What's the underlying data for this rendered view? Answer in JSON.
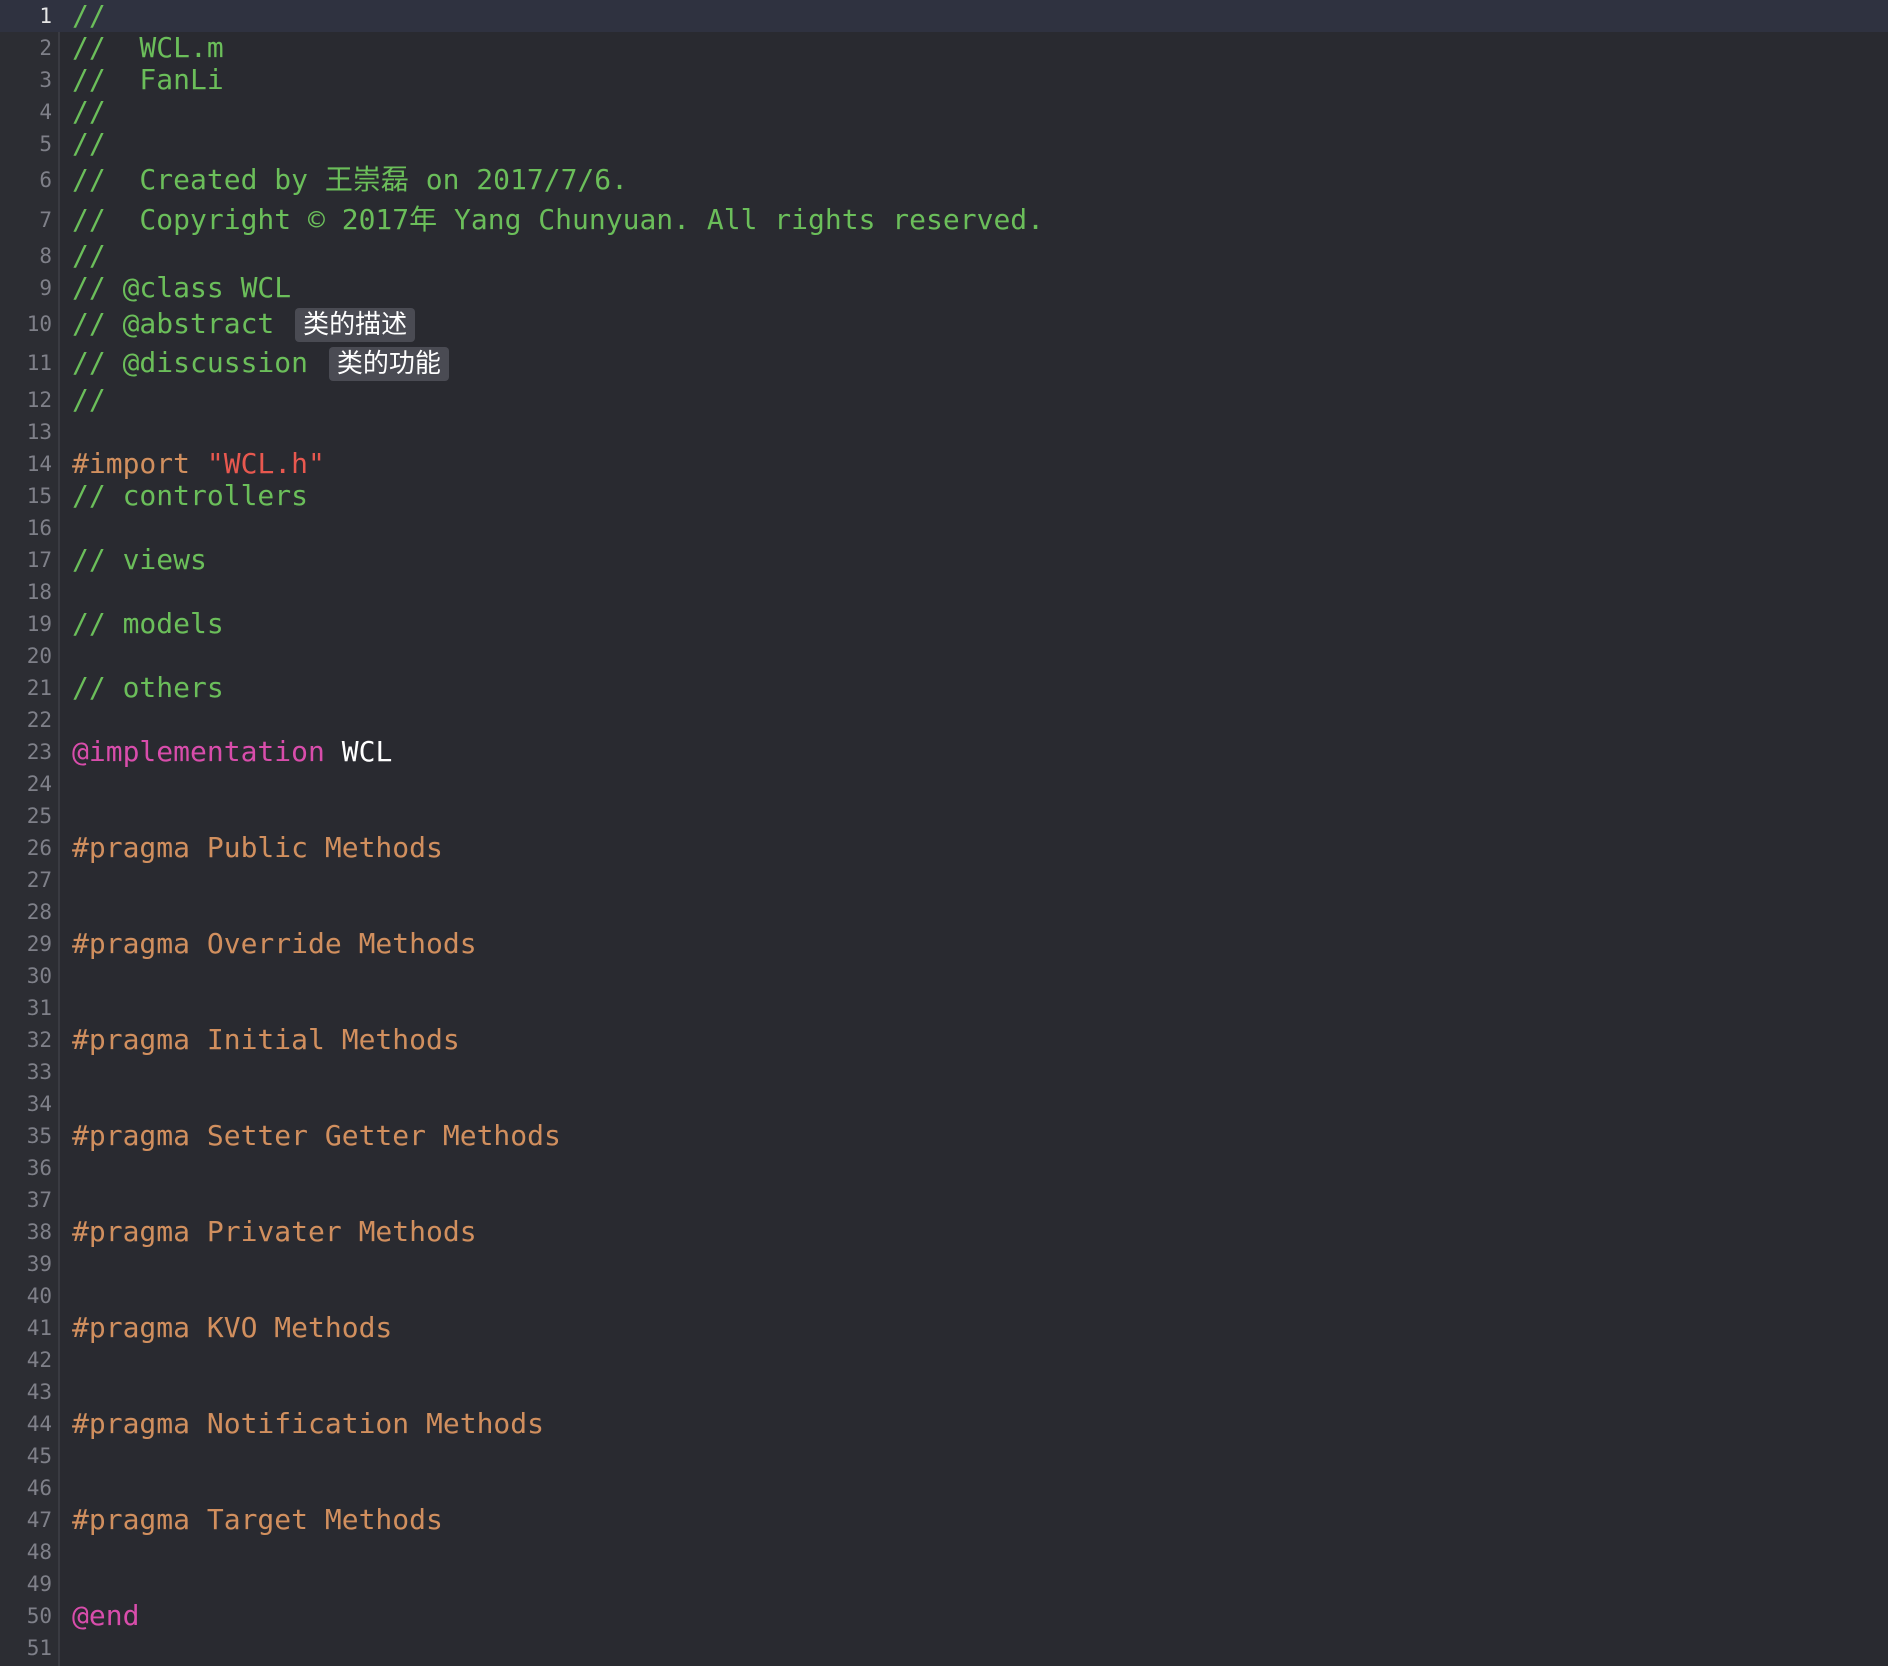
{
  "editor": {
    "current_line": "1",
    "lines": [
      {
        "num": "1",
        "text": "//"
      },
      {
        "num": "2",
        "text": "//  WCL.m"
      },
      {
        "num": "3",
        "text": "//  FanLi"
      },
      {
        "num": "4",
        "text": "//"
      },
      {
        "num": "5",
        "text": "//"
      },
      {
        "num": "6",
        "text": "//  Created by 王崇磊 on 2017/7/6."
      },
      {
        "num": "7",
        "text": "//  Copyright © 2017年 Yang Chunyuan. All rights reserved."
      },
      {
        "num": "8",
        "text": "//"
      },
      {
        "num": "9",
        "text": "// @class WCL"
      },
      {
        "num": "10",
        "prefix": "// @abstract",
        "badge": "类的描述"
      },
      {
        "num": "11",
        "prefix": "// @discussion",
        "badge": "类的功能"
      },
      {
        "num": "12",
        "text": "//"
      },
      {
        "num": "13",
        "text": ""
      },
      {
        "num": "14",
        "directive": "#import",
        "string": "\"WCL.h\""
      },
      {
        "num": "15",
        "text": "// controllers"
      },
      {
        "num": "16",
        "text": ""
      },
      {
        "num": "17",
        "text": "// views"
      },
      {
        "num": "18",
        "text": ""
      },
      {
        "num": "19",
        "text": "// models"
      },
      {
        "num": "20",
        "text": ""
      },
      {
        "num": "21",
        "text": "// others"
      },
      {
        "num": "22",
        "text": ""
      },
      {
        "num": "23",
        "keyword": "@implementation",
        "name": "WCL"
      },
      {
        "num": "24",
        "text": ""
      },
      {
        "num": "25",
        "text": ""
      },
      {
        "num": "26",
        "pragma": "#pragma Public Methods"
      },
      {
        "num": "27",
        "text": ""
      },
      {
        "num": "28",
        "text": ""
      },
      {
        "num": "29",
        "pragma": "#pragma Override Methods"
      },
      {
        "num": "30",
        "text": ""
      },
      {
        "num": "31",
        "text": ""
      },
      {
        "num": "32",
        "pragma": "#pragma Initial Methods"
      },
      {
        "num": "33",
        "text": ""
      },
      {
        "num": "34",
        "text": ""
      },
      {
        "num": "35",
        "pragma": "#pragma Setter Getter Methods"
      },
      {
        "num": "36",
        "text": ""
      },
      {
        "num": "37",
        "text": ""
      },
      {
        "num": "38",
        "pragma": "#pragma Privater Methods"
      },
      {
        "num": "39",
        "text": ""
      },
      {
        "num": "40",
        "text": ""
      },
      {
        "num": "41",
        "pragma": "#pragma KVO Methods"
      },
      {
        "num": "42",
        "text": ""
      },
      {
        "num": "43",
        "text": ""
      },
      {
        "num": "44",
        "pragma": "#pragma Notification Methods"
      },
      {
        "num": "45",
        "text": ""
      },
      {
        "num": "46",
        "text": ""
      },
      {
        "num": "47",
        "pragma": "#pragma Target Methods"
      },
      {
        "num": "48",
        "text": ""
      },
      {
        "num": "49",
        "text": ""
      },
      {
        "num": "50",
        "keyword": "@end"
      },
      {
        "num": "51",
        "text": ""
      }
    ]
  }
}
